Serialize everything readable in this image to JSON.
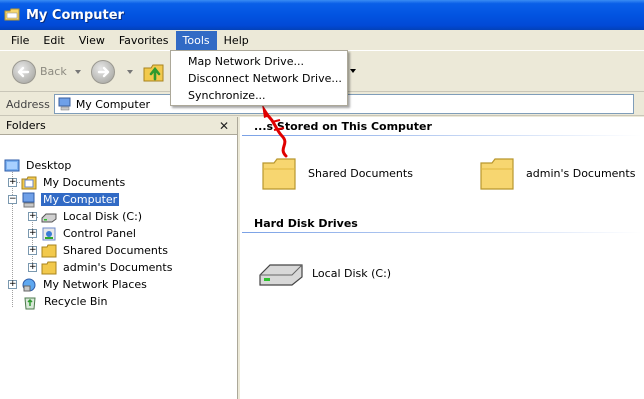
{
  "window": {
    "title": "My Computer"
  },
  "menubar": {
    "items": [
      {
        "label": "File"
      },
      {
        "label": "Edit"
      },
      {
        "label": "View"
      },
      {
        "label": "Favorites"
      },
      {
        "label": "Tools"
      },
      {
        "label": "Help"
      }
    ],
    "active": "Tools"
  },
  "toolbar": {
    "back_label": "Back"
  },
  "addressbar": {
    "label": "Address",
    "value": "My Computer"
  },
  "tools_menu": {
    "items": [
      {
        "label": "Map Network Drive..."
      },
      {
        "label": "Disconnect Network Drive..."
      },
      {
        "label": "Synchronize..."
      }
    ]
  },
  "folders_pane": {
    "title": "Folders",
    "close_glyph": "✕",
    "tree": [
      {
        "label": "Desktop",
        "icon": "desktop-icon",
        "level": 0
      },
      {
        "label": "My Documents",
        "icon": "my-documents-icon",
        "level": 1
      },
      {
        "label": "My Computer",
        "icon": "my-computer-icon",
        "level": 1,
        "selected": true
      },
      {
        "label": "Local Disk (C:)",
        "icon": "local-disk-icon",
        "level": 2
      },
      {
        "label": "Control Panel",
        "icon": "control-panel-icon",
        "level": 2
      },
      {
        "label": "Shared Documents",
        "icon": "folder-icon",
        "level": 2
      },
      {
        "label": "admin's Documents",
        "icon": "folder-icon",
        "level": 2
      },
      {
        "label": "My Network Places",
        "icon": "network-places-icon",
        "level": 1
      },
      {
        "label": "Recycle Bin",
        "icon": "recycle-bin-icon",
        "level": 1
      }
    ]
  },
  "main": {
    "group1": {
      "title_visible": "...s Stored on This Computer",
      "items": [
        {
          "label": "Shared Documents",
          "icon": "folder-icon"
        },
        {
          "label": "admin's Documents",
          "icon": "folder-icon"
        }
      ]
    },
    "group2": {
      "title": "Hard Disk Drives",
      "items": [
        {
          "label": "Local Disk (C:)",
          "icon": "hard-disk-icon"
        }
      ]
    }
  },
  "colors": {
    "titlebar": "#0254E1",
    "selection": "#316AC5",
    "annotation": "#E00000"
  }
}
